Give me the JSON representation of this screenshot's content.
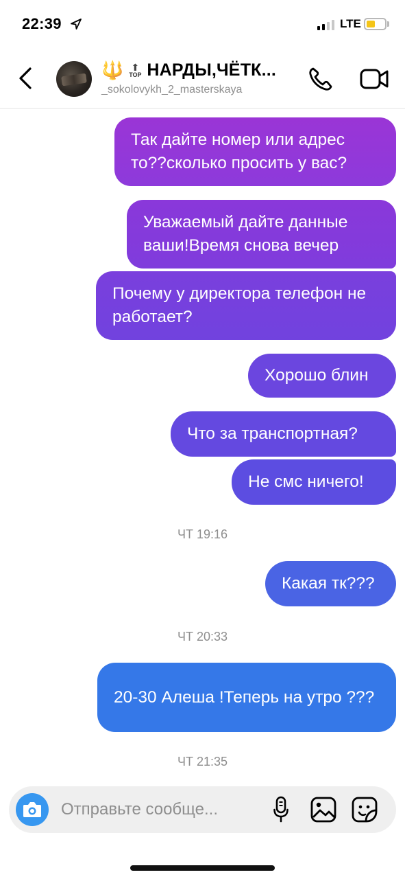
{
  "status_bar": {
    "time": "22:39",
    "network": "LTE",
    "battery_color": "#f5c518",
    "signal_bars_active": 2,
    "signal_bars_total": 4
  },
  "header": {
    "back_icon": "chevron-left-icon",
    "title": "НАРДЫ,ЧЁТК...",
    "top_badge": "TOP",
    "username": "_sokolovykh_2_masterskaya",
    "call_icon": "phone-icon",
    "video_icon": "video-camera-icon"
  },
  "conversation": {
    "gradient_top": "#9a35d6",
    "gradient_bottom": "#2f7ee8",
    "messages": [
      {
        "text": "Так дайте номер или адрес то??сколько просить у вас?"
      },
      {
        "text": "Уважаемый дайте данные ваши!Время снова вечер"
      },
      {
        "text": "Почему у директора телефон не работает?"
      },
      {
        "text": "Хорошо блин"
      },
      {
        "text": "Что за транспортная?"
      },
      {
        "text": "Не смс ничего!"
      },
      {
        "text": "Какая тк???"
      },
      {
        "text": "20-30 Алеша !Теперь на утро ???"
      }
    ],
    "timestamps": [
      "ЧТ 19:16",
      "ЧТ 20:33",
      "ЧТ 21:35"
    ]
  },
  "composer": {
    "placeholder": "Отправьте сообще...",
    "camera_icon": "camera-icon",
    "mic_icon": "microphone-icon",
    "gallery_icon": "image-icon",
    "sticker_icon": "sticker-icon",
    "accent": "#3797f0"
  }
}
